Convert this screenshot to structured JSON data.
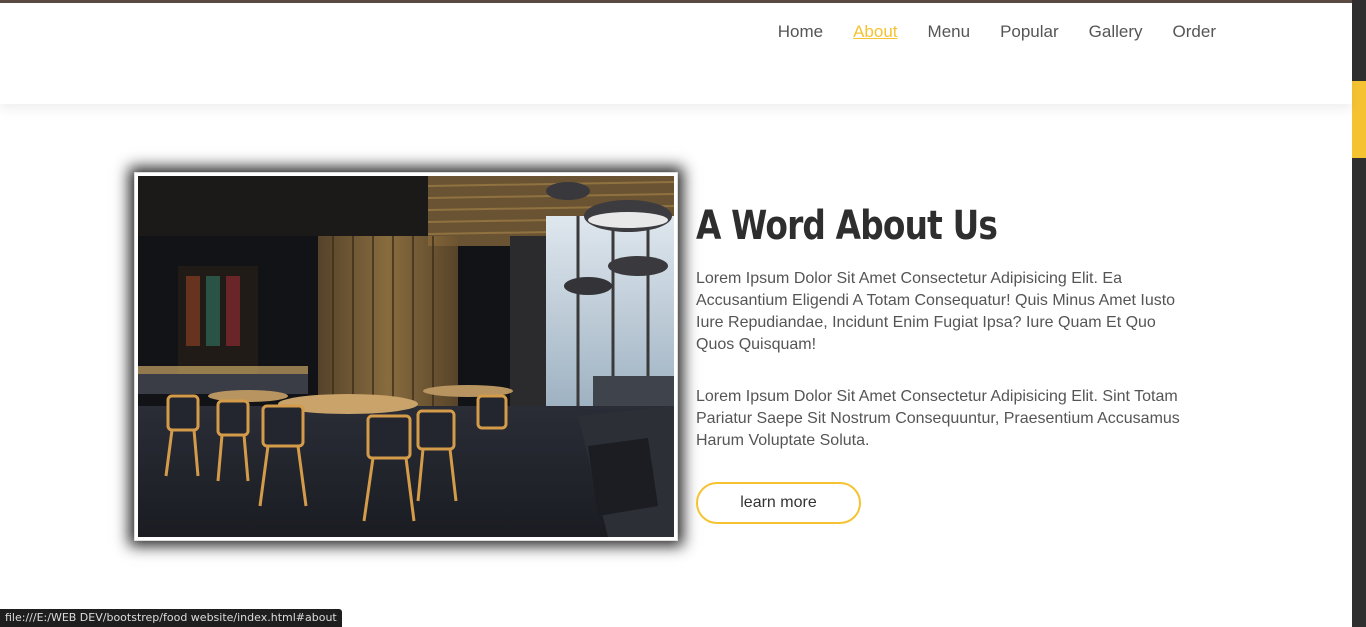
{
  "nav": {
    "items": [
      {
        "label": "Home",
        "active": false
      },
      {
        "label": "About",
        "active": true
      },
      {
        "label": "Menu",
        "active": false
      },
      {
        "label": "Popular",
        "active": false
      },
      {
        "label": "Gallery",
        "active": false
      },
      {
        "label": "Order",
        "active": false
      }
    ]
  },
  "about": {
    "heading": "A Word About Us",
    "paragraph1": "Lorem Ipsum Dolor Sit Amet Consectetur Adipisicing Elit. Ea Accusantium Eligendi A Totam Consequatur! Quis Minus Amet Iusto Iure Repudiandae, Incidunt Enim Fugiat Ipsa? Iure Quam Et Quo Quos Quisquam!",
    "paragraph2": "Lorem Ipsum Dolor Sit Amet Consectetur Adipisicing Elit. Sint Totam Pariatur Saepe Sit Nostrum Consequuntur, Praesentium Accusamus Harum Voluptate Soluta.",
    "button_label": "learn more",
    "image": "restaurant-interior-photo"
  },
  "status_bar": {
    "url": "file:///E:/WEB DEV/bootstrep/food website/index.html#about"
  },
  "colors": {
    "accent": "#f5c332",
    "heading": "#2e2e2e",
    "body_text": "#555555",
    "scrollbar_track": "#2f2f2f"
  }
}
